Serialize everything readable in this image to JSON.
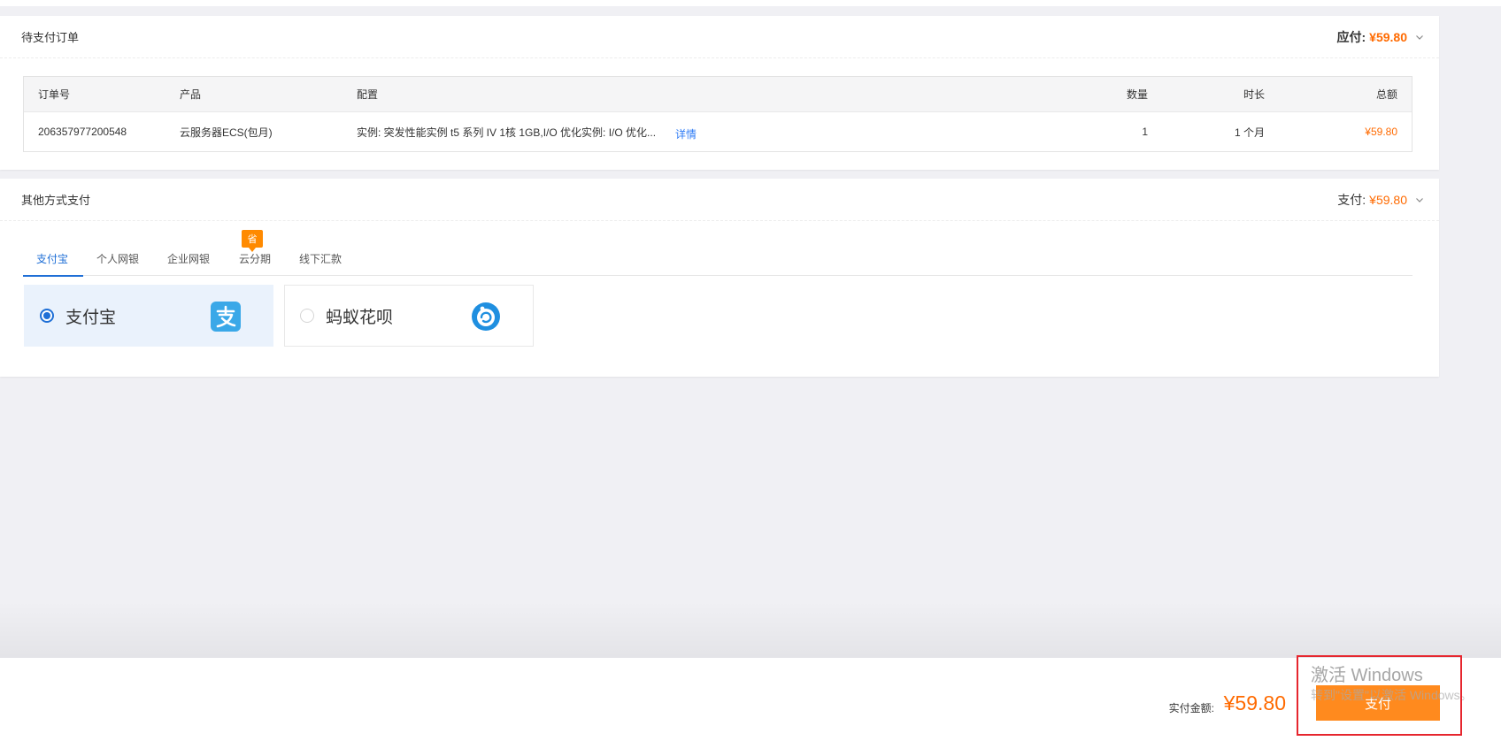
{
  "order_card": {
    "title": "待支付订单",
    "due_label": "应付:",
    "due_amount": "¥59.80",
    "table": {
      "headers": {
        "order_no": "订单号",
        "product": "产品",
        "config": "配置",
        "quantity": "数量",
        "duration": "时长",
        "total": "总额"
      },
      "rows": [
        {
          "order_no": "206357977200548",
          "product": "云服务器ECS(包月)",
          "config": "实例: 突发性能实例 t5 系列 IV 1核 1GB,I/O 优化实例: I/O 优化...",
          "detail_link": "详情",
          "quantity": "1",
          "duration": "1 个月",
          "total": "¥59.80"
        }
      ]
    }
  },
  "pay_card": {
    "title": "其他方式支付",
    "pay_label": "支付:",
    "pay_amount": "¥59.80",
    "tabs": [
      {
        "label": "支付宝",
        "active": true
      },
      {
        "label": "个人网银",
        "active": false
      },
      {
        "label": "企业网银",
        "active": false
      },
      {
        "label": "云分期",
        "active": false
      },
      {
        "label": "线下汇款",
        "active": false
      }
    ],
    "save_badge": "省",
    "methods": [
      {
        "label": "支付宝",
        "selected": true,
        "icon": "alipay-icon"
      },
      {
        "label": "蚂蚁花呗",
        "selected": false,
        "icon": "huabei-icon"
      }
    ]
  },
  "footer": {
    "total_label": "实付金额:",
    "total_amount": "¥59.80",
    "pay_button": "支付"
  },
  "watermark": {
    "title": "激活 Windows",
    "subtitle": "转到\"设置\"以激活 Windows。"
  },
  "colors": {
    "accent_orange": "#ff6a00",
    "button_orange": "#ff8a1e",
    "tab_blue": "#1f6fd6",
    "link_blue": "#2f7cf6",
    "alipay_blue": "#3aa8e8",
    "highlight_red": "#e6262e"
  }
}
